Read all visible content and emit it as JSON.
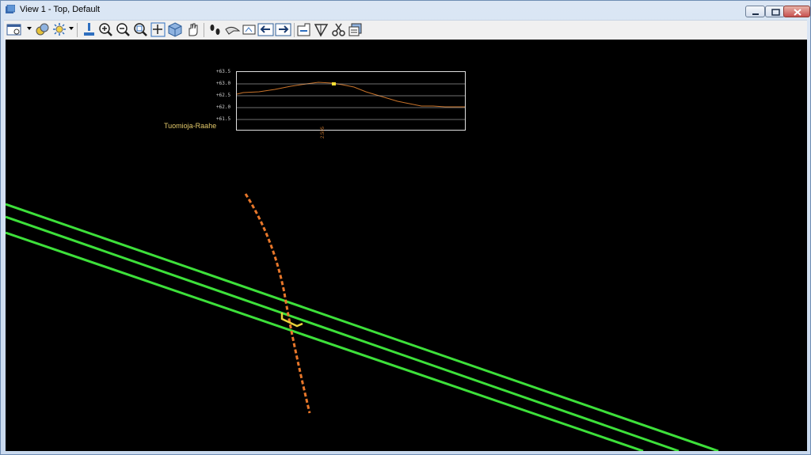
{
  "window": {
    "title": "View 1 - Top, Default",
    "controls": [
      "minimize",
      "maximize",
      "close"
    ]
  },
  "toolbar": {
    "tools": [
      {
        "name": "view-attributes",
        "icon": "view-attributes-icon",
        "dropdown": true
      },
      {
        "name": "level-display",
        "icon": "level-display-icon"
      },
      {
        "name": "display-style",
        "icon": "display-style-icon",
        "dropdown": true
      },
      {
        "name": "update-view",
        "icon": "brush-icon"
      },
      {
        "name": "zoom-in",
        "icon": "zoom-in-icon"
      },
      {
        "name": "zoom-out",
        "icon": "zoom-out-icon"
      },
      {
        "name": "window-area",
        "icon": "window-area-icon"
      },
      {
        "name": "fit-view",
        "icon": "fit-view-icon"
      },
      {
        "name": "rotate-view",
        "icon": "rotate-cube-icon"
      },
      {
        "name": "pan-view",
        "icon": "hand-icon"
      },
      {
        "name": "walk",
        "icon": "footprints-icon"
      },
      {
        "name": "fly",
        "icon": "glider-icon"
      },
      {
        "name": "view-previous-clip",
        "icon": "camera-icon"
      },
      {
        "name": "view-previous",
        "icon": "arrow-left-icon"
      },
      {
        "name": "view-next",
        "icon": "arrow-right-icon"
      },
      {
        "name": "clip-volume",
        "icon": "clip-volume-icon"
      },
      {
        "name": "clip-mask",
        "icon": "clip-mask-icon"
      },
      {
        "name": "clear-clip",
        "icon": "scissors-icon"
      },
      {
        "name": "copy-view",
        "icon": "copy-view-icon"
      }
    ]
  },
  "profile": {
    "name": "Tuomioja-Raahe",
    "y_labels": [
      "+63.5",
      "+63.0",
      "+62.5",
      "+62.0",
      "+61.5"
    ],
    "station_label": "2.505",
    "colors": {
      "frame": "#e0e0e0",
      "line": "#c8732a",
      "marker": "#ffe033",
      "label": "#e3c96a"
    }
  },
  "plan": {
    "colors": {
      "track": "#3de03a",
      "alignment": "#e8772a",
      "cursor": "#e8d23a",
      "background": "#000000"
    }
  }
}
